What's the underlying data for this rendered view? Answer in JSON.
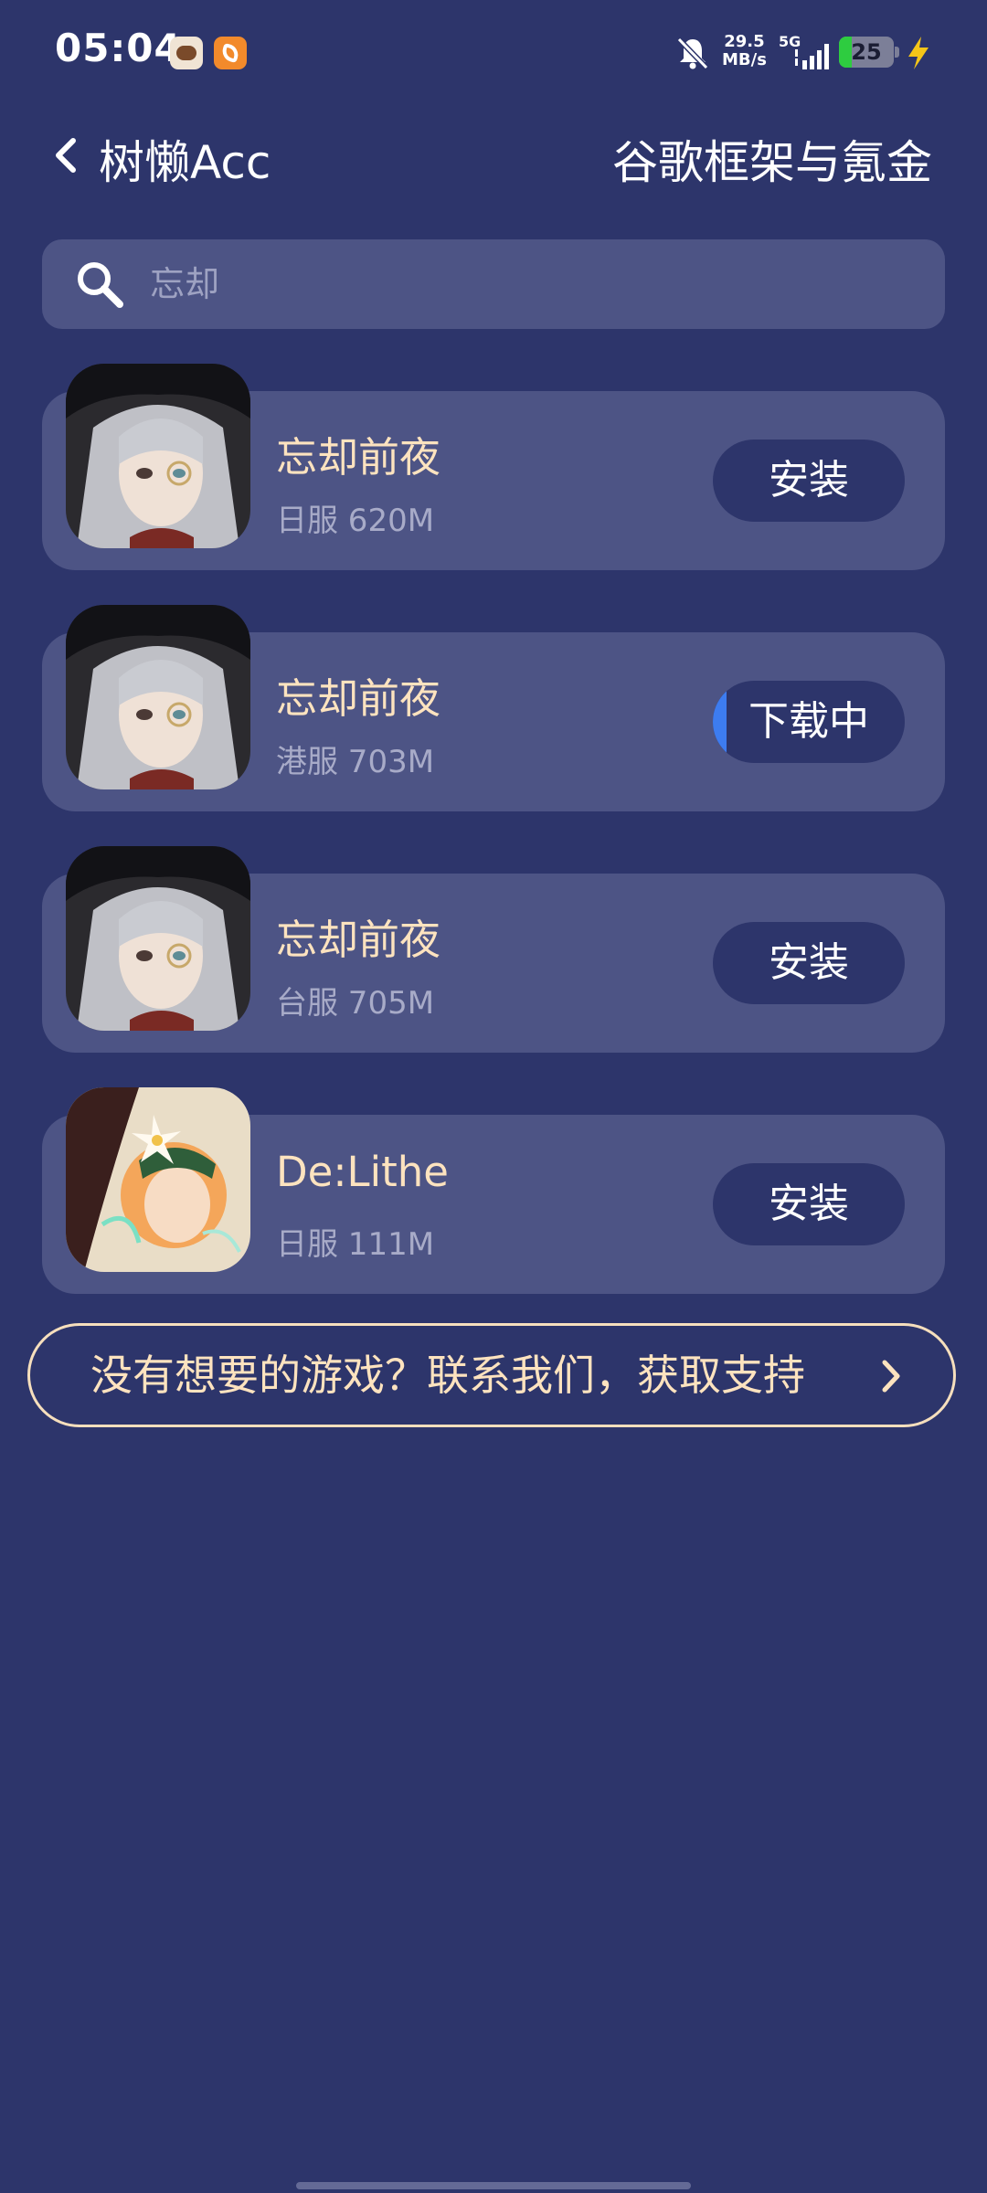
{
  "status_bar": {
    "time": "05:04",
    "speed_value": "29.5",
    "speed_unit": "MB/s",
    "network": "5G",
    "battery": "25",
    "icons": [
      "app-icon-pig",
      "app-icon-orange",
      "bell-muted-icon",
      "signal-icon",
      "battery-icon",
      "charging-bolt-icon"
    ]
  },
  "header": {
    "title": "树懒Acc",
    "right_title": "谷歌框架与氪金",
    "back_icon": "chevron-left-icon"
  },
  "search": {
    "value": "忘却",
    "icon": "search-icon"
  },
  "games": [
    {
      "name": "忘却前夜",
      "meta": "日服 620M",
      "button": "安装",
      "status": "install"
    },
    {
      "name": "忘却前夜",
      "meta": "港服 703M",
      "button": "下载中",
      "status": "downloading",
      "progress": 0.07
    },
    {
      "name": "忘却前夜",
      "meta": "台服 705M",
      "button": "安装",
      "status": "install"
    },
    {
      "name": "De:Lithe",
      "meta": "日服 111M",
      "button": "安装",
      "status": "install"
    }
  ],
  "support": {
    "label": "没有想要的游戏？联系我们，获取支持"
  },
  "colors": {
    "background": "#2d356b",
    "card": "#4d5485",
    "accent_text": "#fde3bf",
    "progress": "#3d7cf0"
  }
}
